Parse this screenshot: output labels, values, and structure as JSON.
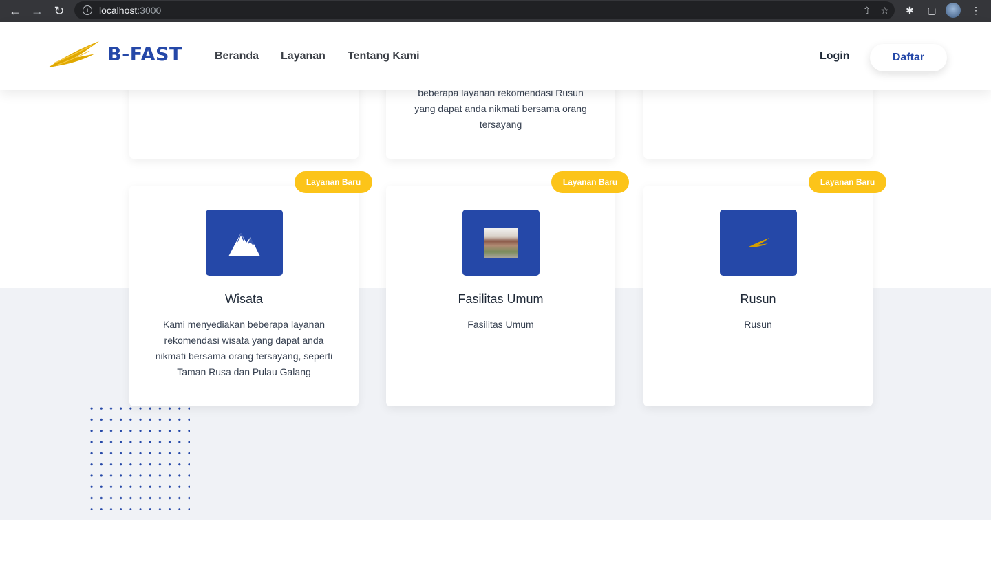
{
  "browser": {
    "url_host": "localhost",
    "url_port": ":3000"
  },
  "header": {
    "brand": "B-FAST",
    "nav": [
      "Beranda",
      "Layanan",
      "Tentang Kami"
    ],
    "login_label": "Login",
    "register_label": "Daftar"
  },
  "top_cards": [
    {
      "text": ""
    },
    {
      "text": "beberapa layanan rekomendasi Rusun yang dapat anda nikmati bersama orang tersayang"
    },
    {
      "text": ""
    }
  ],
  "services": [
    {
      "badge": "Layanan Baru",
      "title": "Wisata",
      "description": "Kami menyediakan beberapa layanan rekomendasi wisata yang dapat anda nikmati bersama orang tersayang, seperti Taman Rusa dan Pulau Galang",
      "icon": "mountain-icon"
    },
    {
      "badge": "Layanan Baru",
      "title": "Fasilitas Umum",
      "description": "Fasilitas Umum",
      "icon": "building-photo"
    },
    {
      "badge": "Layanan Baru",
      "title": "Rusun",
      "description": "Rusun",
      "icon": "eagle-logo-icon"
    }
  ],
  "colors": {
    "brand_blue": "#2548a8",
    "badge_yellow": "#fcc419",
    "band_gray": "#f0f2f6",
    "logo_gold": "#e0a800"
  }
}
